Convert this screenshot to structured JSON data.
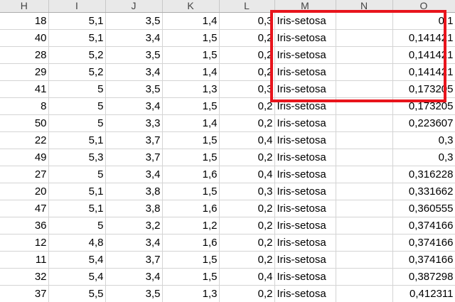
{
  "columns": [
    "H",
    "I",
    "J",
    "K",
    "L",
    "M",
    "N",
    "O"
  ],
  "rows": [
    [
      "18",
      "5,1",
      "3,5",
      "1,4",
      "0,3",
      "Iris-setosa",
      "",
      "0,1"
    ],
    [
      "40",
      "5,1",
      "3,4",
      "1,5",
      "0,2",
      "Iris-setosa",
      "",
      "0,141421"
    ],
    [
      "28",
      "5,2",
      "3,5",
      "1,5",
      "0,2",
      "Iris-setosa",
      "",
      "0,141421"
    ],
    [
      "29",
      "5,2",
      "3,4",
      "1,4",
      "0,2",
      "Iris-setosa",
      "",
      "0,141421"
    ],
    [
      "41",
      "5",
      "3,5",
      "1,3",
      "0,3",
      "Iris-setosa",
      "",
      "0,173205"
    ],
    [
      "8",
      "5",
      "3,4",
      "1,5",
      "0,2",
      "Iris-setosa",
      "",
      "0,173205"
    ],
    [
      "50",
      "5",
      "3,3",
      "1,4",
      "0,2",
      "Iris-setosa",
      "",
      "0,223607"
    ],
    [
      "22",
      "5,1",
      "3,7",
      "1,5",
      "0,4",
      "Iris-setosa",
      "",
      "0,3"
    ],
    [
      "49",
      "5,3",
      "3,7",
      "1,5",
      "0,2",
      "Iris-setosa",
      "",
      "0,3"
    ],
    [
      "27",
      "5",
      "3,4",
      "1,6",
      "0,4",
      "Iris-setosa",
      "",
      "0,316228"
    ],
    [
      "20",
      "5,1",
      "3,8",
      "1,5",
      "0,3",
      "Iris-setosa",
      "",
      "0,331662"
    ],
    [
      "47",
      "5,1",
      "3,8",
      "1,6",
      "0,2",
      "Iris-setosa",
      "",
      "0,360555"
    ],
    [
      "36",
      "5",
      "3,2",
      "1,2",
      "0,2",
      "Iris-setosa",
      "",
      "0,374166"
    ],
    [
      "12",
      "4,8",
      "3,4",
      "1,6",
      "0,2",
      "Iris-setosa",
      "",
      "0,374166"
    ],
    [
      "11",
      "5,4",
      "3,7",
      "1,5",
      "0,2",
      "Iris-setosa",
      "",
      "0,374166"
    ],
    [
      "32",
      "5,4",
      "3,4",
      "1,5",
      "0,4",
      "Iris-setosa",
      "",
      "0,387298"
    ],
    [
      "37",
      "5,5",
      "3,5",
      "1,3",
      "0,2",
      "Iris-setosa",
      "",
      "0,412311"
    ]
  ],
  "text_columns": [
    5
  ],
  "highlight": {
    "color": "#e8141c",
    "covers_columns": [
      "M",
      "N",
      "O"
    ],
    "covers_row_count": 5
  },
  "colors": {
    "header_background": "#e9e9e9",
    "gridline": "#d4d4d4"
  }
}
